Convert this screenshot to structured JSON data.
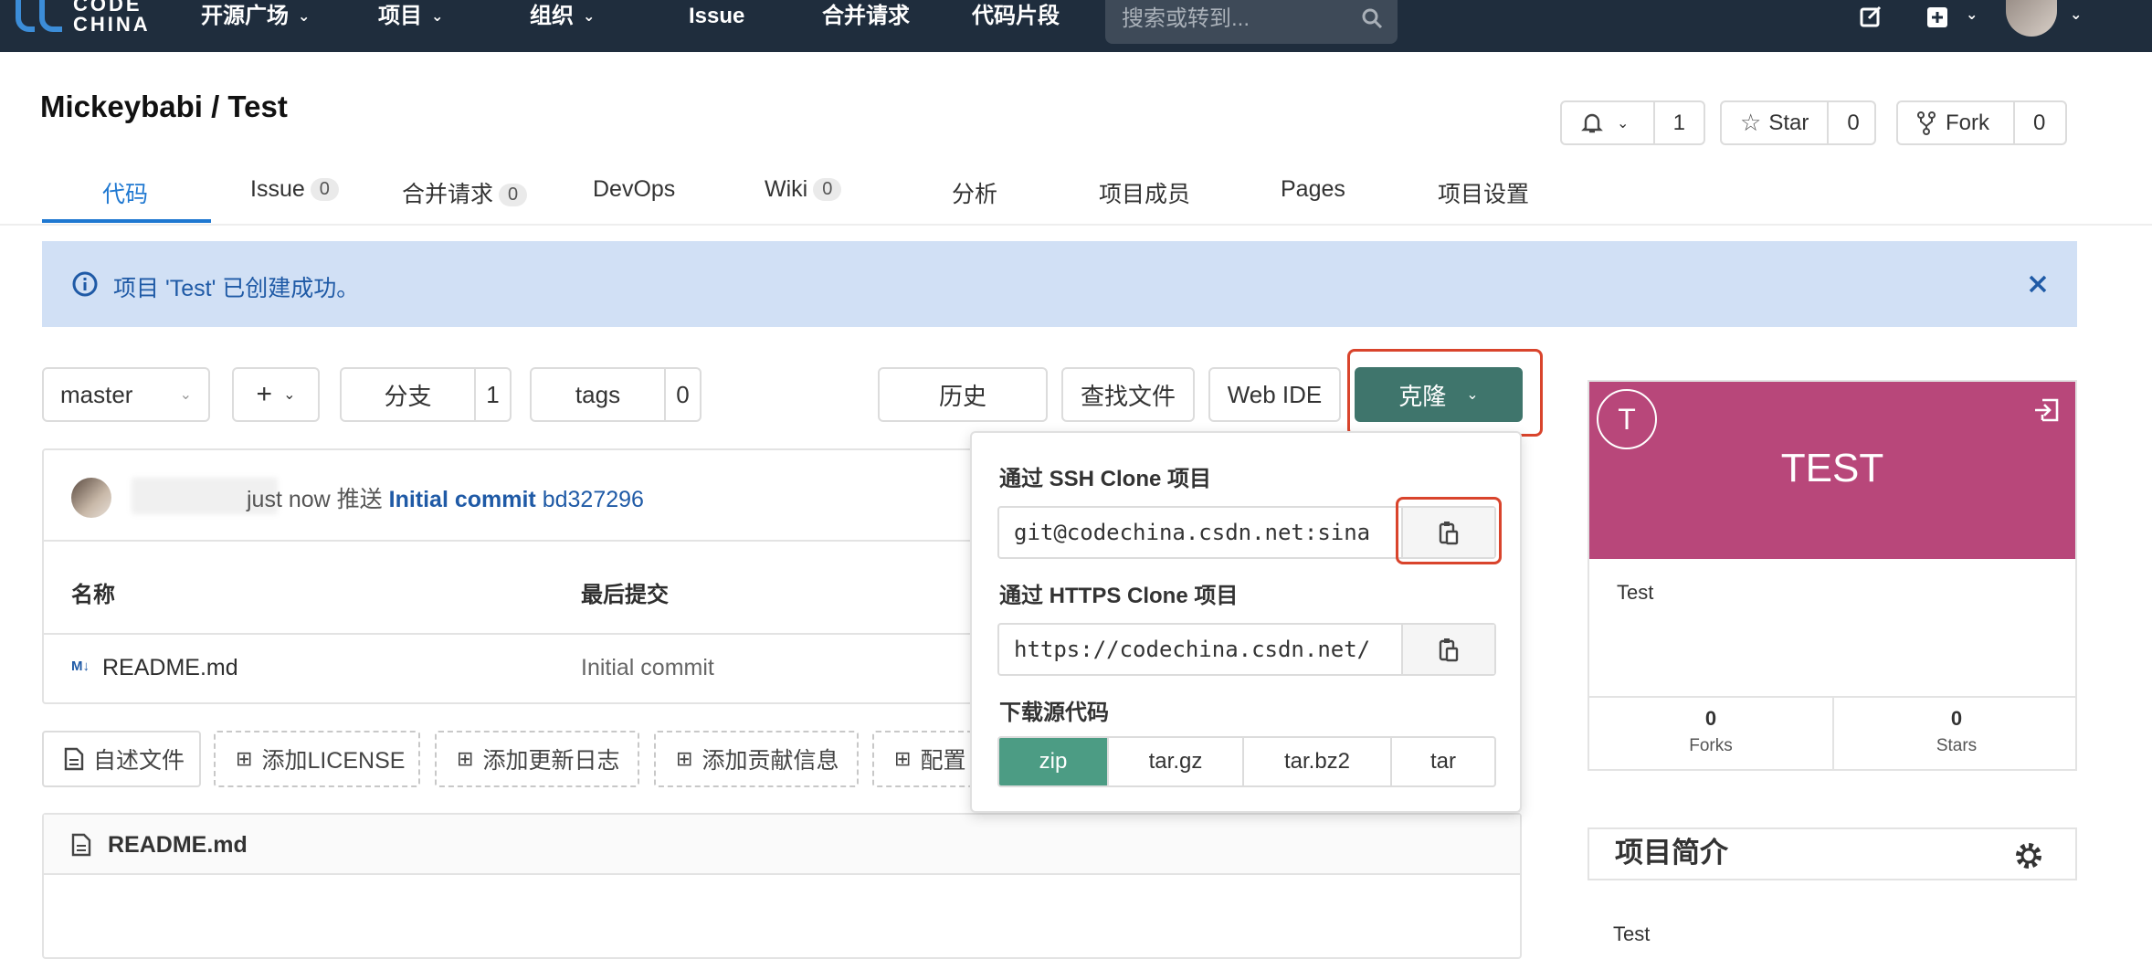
{
  "nav": {
    "logo_line1": "CODE",
    "logo_line2": "CHINA",
    "items": [
      "开源广场",
      "项目",
      "组织",
      "Issue",
      "合并请求",
      "代码片段"
    ],
    "search_placeholder": "搜索或转到..."
  },
  "project": {
    "title": "Mickeybabi / Test",
    "notify_count": "1",
    "star_label": "Star",
    "star_count": "0",
    "fork_label": "Fork",
    "fork_count": "0"
  },
  "tabs": [
    {
      "label": "代码"
    },
    {
      "label": "Issue",
      "count": "0"
    },
    {
      "label": "合并请求",
      "count": "0"
    },
    {
      "label": "DevOps"
    },
    {
      "label": "Wiki",
      "count": "0"
    },
    {
      "label": "分析"
    },
    {
      "label": "项目成员"
    },
    {
      "label": "Pages"
    },
    {
      "label": "项目设置"
    }
  ],
  "alert": {
    "text": "项目 'Test' 已创建成功。"
  },
  "toolbar": {
    "branch": "master",
    "add": "+",
    "branches_label": "分支",
    "branches_count": "1",
    "tags_label": "tags",
    "tags_count": "0",
    "history": "历史",
    "find_file": "查找文件",
    "web_ide": "Web IDE",
    "clone": "克隆"
  },
  "commit": {
    "prefix": "just now 推送",
    "message": "Initial commit",
    "hash": "bd327296"
  },
  "files": {
    "headers": [
      "名称",
      "最后提交"
    ],
    "rows": [
      {
        "name": "README.md",
        "commit": "Initial commit"
      }
    ]
  },
  "doc_buttons": [
    "自述文件",
    "添加LICENSE",
    "添加更新日志",
    "添加贡献信息",
    "配置"
  ],
  "readme": {
    "title": "README.md"
  },
  "clone_menu": {
    "ssh_label": "通过 SSH Clone 项目",
    "ssh_url": "git@codechina.csdn.net:sina",
    "https_label": "通过 HTTPS Clone 项目",
    "https_url": "https://codechina.csdn.net/",
    "download_label": "下载源代码",
    "formats": [
      "zip",
      "tar.gz",
      "tar.bz2",
      "tar"
    ],
    "selected_format": "zip"
  },
  "card": {
    "letter": "T",
    "name": "TEST",
    "description": "Test",
    "forks_count": "0",
    "forks_label": "Forks",
    "stars_count": "0",
    "stars_label": "Stars",
    "banner_color": "#b8477a"
  },
  "intro": {
    "title": "项目简介",
    "text": "Test"
  },
  "colors": {
    "nav_bg": "#1f2d3d",
    "accent": "#1f78d1",
    "clone_btn": "#3f756c",
    "highlight": "#d9442c"
  }
}
